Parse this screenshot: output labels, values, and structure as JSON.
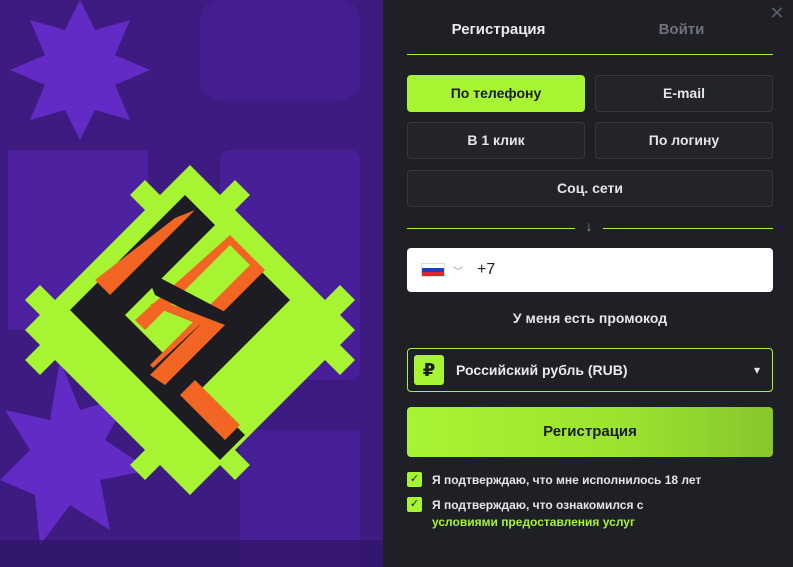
{
  "tabs": [
    {
      "label": "Регистрация",
      "active": true
    },
    {
      "label": "Войти",
      "active": false
    }
  ],
  "methods": {
    "phone": "По телефону",
    "email": "E-mail",
    "one_click": "В 1 клик",
    "login": "По логину",
    "social": "Соц. сети"
  },
  "divider_arrow": "↓",
  "phone_field": {
    "country_flag": "russia-flag",
    "value": "+7"
  },
  "promo_label": "У меня есть промокод",
  "currency": {
    "icon_symbol": "₽",
    "label": "Российский рубль (RUB)"
  },
  "submit_label": "Регистрация",
  "consents": {
    "age": "Я подтверждаю, что мне исполнилось 18 лет",
    "terms_prefix": "Я подтверждаю, что ознакомился с",
    "terms_link": "условиями предоставления услуг"
  },
  "colors": {
    "accent": "#a7f432",
    "panel_bg": "#1e2026",
    "art_bg": "#3a1a7a",
    "logo_orange": "#f26522"
  }
}
